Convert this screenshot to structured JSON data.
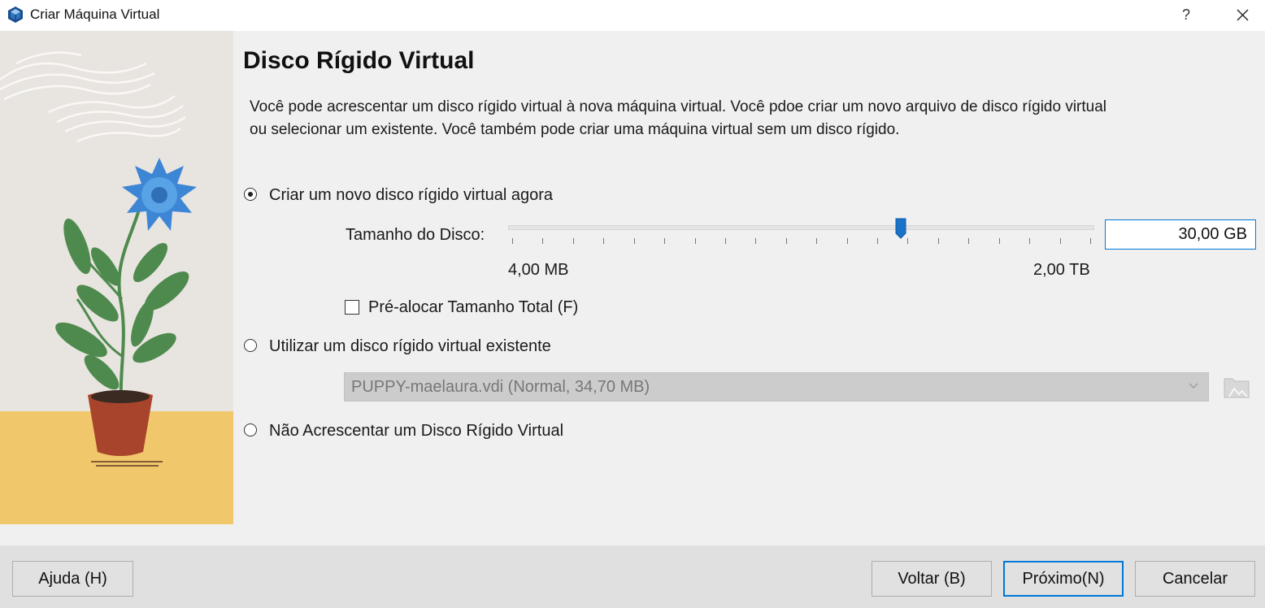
{
  "window": {
    "title": "Criar Máquina Virtual",
    "help_symbol": "?",
    "app_icon": "virtualbox-icon"
  },
  "page": {
    "heading": "Disco Rígido Virtual",
    "description": "Você pode acrescentar um disco rígido virtual à nova máquina virtual. Você pdoe criar um novo arquivo de disco rígido virtual ou selecionar um existente. Você também pode criar uma máquina virtual sem um disco rígido."
  },
  "options": {
    "create_new": {
      "label": "Criar um novo disco rígido virtual agora",
      "selected": true
    },
    "use_existing": {
      "label": "Utilizar um disco rígido virtual existente",
      "selected": false
    },
    "no_disk": {
      "label": "Não Acrescentar um Disco Rígido Virtual",
      "selected": false
    }
  },
  "disk_size": {
    "label": "Tamanho do Disco:",
    "value": "30,00 GB",
    "min_label": "4,00 MB",
    "max_label": "2,00 TB",
    "slider_position_fraction": 0.67
  },
  "preallocate": {
    "label": "Pré-alocar Tamanho Total (F)",
    "checked": false
  },
  "existing_disk": {
    "selected_value": "PUPPY-maelaura.vdi (Normal, 34,70 MB)",
    "enabled": false
  },
  "buttons": {
    "help": "Ajuda (H)",
    "back": "Voltar (B)",
    "next": "Próximo(N)",
    "cancel": "Cancelar"
  },
  "colors": {
    "accent": "#0078d7",
    "slider_thumb": "#1a73c9",
    "art_sky": "#e8e4df",
    "art_ground": "#f0c76a",
    "flower": "#3d86d6",
    "leaves": "#4e8a4e",
    "pot": "#a8442c"
  }
}
